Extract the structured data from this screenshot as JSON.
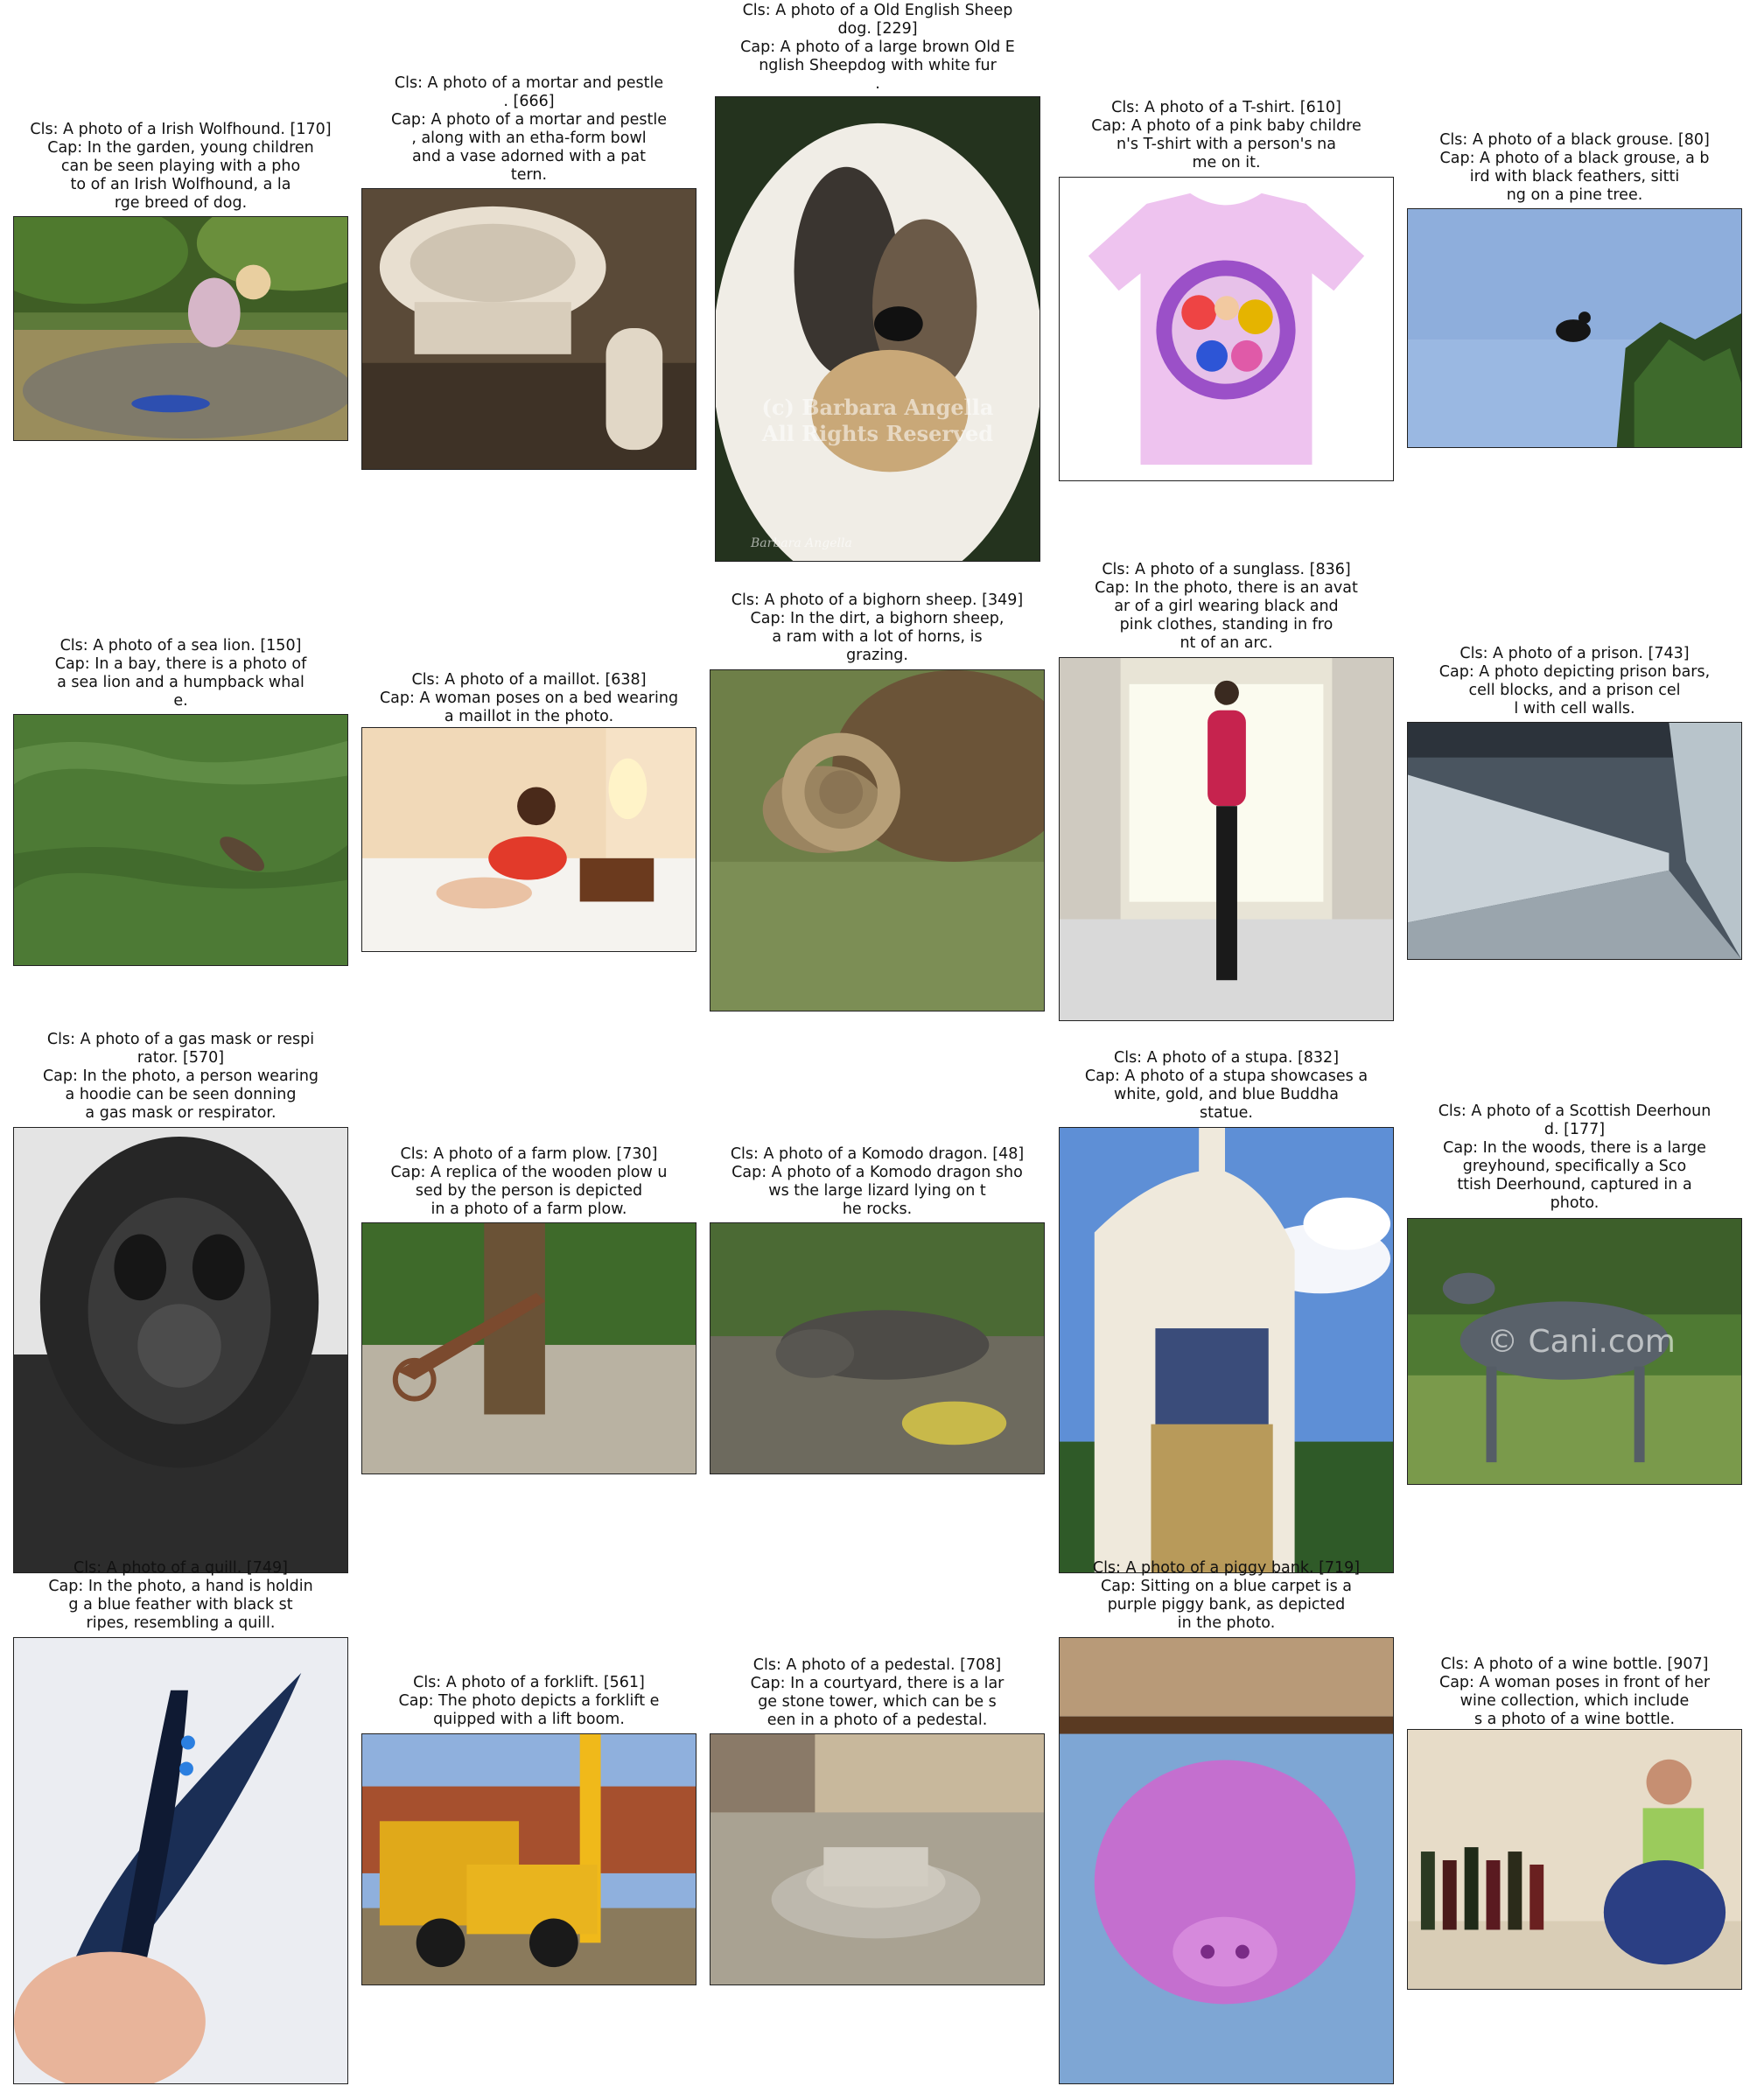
{
  "panels": [
    {
      "caption": "Cls: A photo of a Irish Wolfhound. [170]\nCap: In the garden, young children\ncan be seen playing with a pho\nto of an Irish Wolfhound, a la\nrge breed of dog.",
      "image": "irish-wolfhound-photo"
    },
    {
      "caption": "Cls: A photo of a mortar and pestle\n. [666]\nCap: A photo of a mortar and pestle\n, along with an etha-form bowl\nand a vase adorned with a pat\ntern.",
      "image": "mortar-and-pestle-photo"
    },
    {
      "caption": "Cls: A photo of a Old English Sheep\ndog. [229]\nCap: A photo of a large brown Old E\nnglish Sheepdog with white fur\n.",
      "image": "old-english-sheepdog-photo"
    },
    {
      "caption": "Cls: A photo of a T-shirt. [610]\nCap: A photo of a pink baby childre\nn's T-shirt with a person's na\nme on it.",
      "image": "t-shirt-photo"
    },
    {
      "caption": "Cls: A photo of a black grouse. [80]\nCap: A photo of a black grouse, a b\nird with black feathers, sitti\nng on a pine tree.",
      "image": "black-grouse-photo"
    },
    {
      "caption": "Cls: A photo of a sea lion. [150]\nCap: In a bay, there is a photo of\na sea lion and a humpback whal\ne.",
      "image": "sea-lion-photo"
    },
    {
      "caption": "Cls: A photo of a maillot. [638]\nCap: A woman poses on a bed wearing\na maillot in the photo.",
      "image": "maillot-photo"
    },
    {
      "caption": "Cls: A photo of a bighorn sheep. [349]\nCap: In the dirt, a bighorn sheep,\na ram with a lot of horns, is\ngrazing.",
      "image": "bighorn-sheep-photo"
    },
    {
      "caption": "Cls: A photo of a sunglass. [836]\nCap: In the photo, there is an avat\nar of a girl wearing black and\npink clothes, standing in fro\nnt of an arc.",
      "image": "sunglass-photo"
    },
    {
      "caption": "Cls: A photo of a prison. [743]\nCap: A photo depicting prison bars,\ncell blocks, and a prison cel\nl with cell walls.",
      "image": "prison-photo"
    },
    {
      "caption": "Cls: A photo of a gas mask or respi\nrator. [570]\nCap: In the photo, a person wearing\na hoodie can be seen donning\na gas mask or respirator.",
      "image": "gas-mask-photo"
    },
    {
      "caption": "Cls: A photo of a farm plow. [730]\nCap: A replica of the wooden plow u\nsed by the person is depicted\nin a photo of a farm plow.",
      "image": "farm-plow-photo"
    },
    {
      "caption": "Cls: A photo of a Komodo dragon. [48]\nCap: A photo of a Komodo dragon sho\nws the large lizard lying on t\nhe rocks.",
      "image": "komodo-dragon-photo"
    },
    {
      "caption": "Cls: A photo of a stupa. [832]\nCap: A photo of a stupa showcases a\nwhite, gold, and blue Buddha\nstatue.",
      "image": "stupa-photo"
    },
    {
      "caption": "Cls: A photo of a Scottish Deerhoun\nd. [177]\nCap: In the woods, there is a large\ngreyhound, specifically a Sco\nttish Deerhound, captured in a\nphoto.",
      "image": "scottish-deerhound-photo"
    },
    {
      "caption": "Cls: A photo of a quill. [749]\nCap: In the photo, a hand is holdin\ng a blue feather with black st\nripes, resembling a quill.",
      "image": "quill-photo"
    },
    {
      "caption": "Cls: A photo of a forklift. [561]\nCap: The photo depicts a forklift e\nquipped with a lift boom.",
      "image": "forklift-photo"
    },
    {
      "caption": "Cls: A photo of a pedestal. [708]\nCap: In a courtyard, there is a lar\nge stone tower, which can be s\neen in a photo of a pedestal.",
      "image": "pedestal-photo"
    },
    {
      "caption": "Cls: A photo of a piggy bank. [719]\nCap: Sitting on a blue carpet is a\npurple piggy bank, as depicted\nin the photo.",
      "image": "piggy-bank-photo"
    },
    {
      "caption": "Cls: A photo of a wine bottle. [907]\nCap: A woman poses in front of her\nwine collection, which include\ns a photo of a wine bottle.",
      "image": "wine-bottle-photo"
    }
  ],
  "watermarks": {
    "sheepdog": "(c) Barbara Angella\nAll Rights Reserved",
    "sheepdog_signature": "Barbara Angella",
    "deerhound": "© Cani.com"
  }
}
